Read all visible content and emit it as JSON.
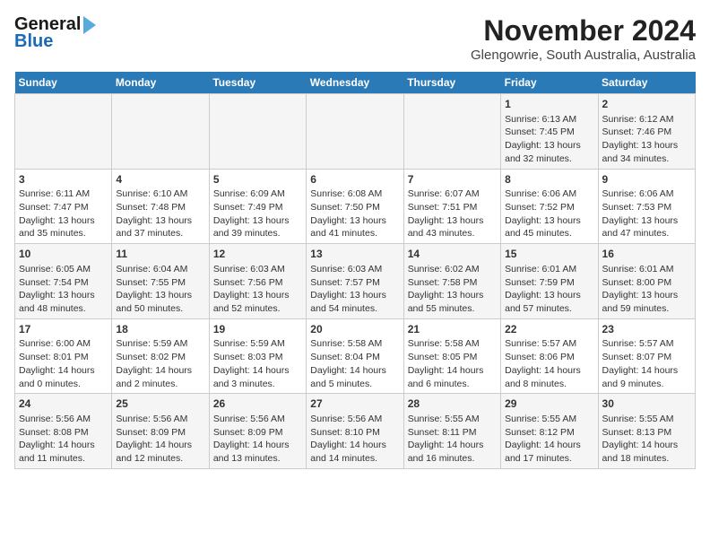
{
  "header": {
    "logo_line1": "General",
    "logo_line2": "Blue",
    "title": "November 2024",
    "subtitle": "Glengowrie, South Australia, Australia"
  },
  "calendar": {
    "days_of_week": [
      "Sunday",
      "Monday",
      "Tuesday",
      "Wednesday",
      "Thursday",
      "Friday",
      "Saturday"
    ],
    "weeks": [
      [
        {
          "day": "",
          "info": ""
        },
        {
          "day": "",
          "info": ""
        },
        {
          "day": "",
          "info": ""
        },
        {
          "day": "",
          "info": ""
        },
        {
          "day": "",
          "info": ""
        },
        {
          "day": "1",
          "info": "Sunrise: 6:13 AM\nSunset: 7:45 PM\nDaylight: 13 hours and 32 minutes."
        },
        {
          "day": "2",
          "info": "Sunrise: 6:12 AM\nSunset: 7:46 PM\nDaylight: 13 hours and 34 minutes."
        }
      ],
      [
        {
          "day": "3",
          "info": "Sunrise: 6:11 AM\nSunset: 7:47 PM\nDaylight: 13 hours and 35 minutes."
        },
        {
          "day": "4",
          "info": "Sunrise: 6:10 AM\nSunset: 7:48 PM\nDaylight: 13 hours and 37 minutes."
        },
        {
          "day": "5",
          "info": "Sunrise: 6:09 AM\nSunset: 7:49 PM\nDaylight: 13 hours and 39 minutes."
        },
        {
          "day": "6",
          "info": "Sunrise: 6:08 AM\nSunset: 7:50 PM\nDaylight: 13 hours and 41 minutes."
        },
        {
          "day": "7",
          "info": "Sunrise: 6:07 AM\nSunset: 7:51 PM\nDaylight: 13 hours and 43 minutes."
        },
        {
          "day": "8",
          "info": "Sunrise: 6:06 AM\nSunset: 7:52 PM\nDaylight: 13 hours and 45 minutes."
        },
        {
          "day": "9",
          "info": "Sunrise: 6:06 AM\nSunset: 7:53 PM\nDaylight: 13 hours and 47 minutes."
        }
      ],
      [
        {
          "day": "10",
          "info": "Sunrise: 6:05 AM\nSunset: 7:54 PM\nDaylight: 13 hours and 48 minutes."
        },
        {
          "day": "11",
          "info": "Sunrise: 6:04 AM\nSunset: 7:55 PM\nDaylight: 13 hours and 50 minutes."
        },
        {
          "day": "12",
          "info": "Sunrise: 6:03 AM\nSunset: 7:56 PM\nDaylight: 13 hours and 52 minutes."
        },
        {
          "day": "13",
          "info": "Sunrise: 6:03 AM\nSunset: 7:57 PM\nDaylight: 13 hours and 54 minutes."
        },
        {
          "day": "14",
          "info": "Sunrise: 6:02 AM\nSunset: 7:58 PM\nDaylight: 13 hours and 55 minutes."
        },
        {
          "day": "15",
          "info": "Sunrise: 6:01 AM\nSunset: 7:59 PM\nDaylight: 13 hours and 57 minutes."
        },
        {
          "day": "16",
          "info": "Sunrise: 6:01 AM\nSunset: 8:00 PM\nDaylight: 13 hours and 59 minutes."
        }
      ],
      [
        {
          "day": "17",
          "info": "Sunrise: 6:00 AM\nSunset: 8:01 PM\nDaylight: 14 hours and 0 minutes."
        },
        {
          "day": "18",
          "info": "Sunrise: 5:59 AM\nSunset: 8:02 PM\nDaylight: 14 hours and 2 minutes."
        },
        {
          "day": "19",
          "info": "Sunrise: 5:59 AM\nSunset: 8:03 PM\nDaylight: 14 hours and 3 minutes."
        },
        {
          "day": "20",
          "info": "Sunrise: 5:58 AM\nSunset: 8:04 PM\nDaylight: 14 hours and 5 minutes."
        },
        {
          "day": "21",
          "info": "Sunrise: 5:58 AM\nSunset: 8:05 PM\nDaylight: 14 hours and 6 minutes."
        },
        {
          "day": "22",
          "info": "Sunrise: 5:57 AM\nSunset: 8:06 PM\nDaylight: 14 hours and 8 minutes."
        },
        {
          "day": "23",
          "info": "Sunrise: 5:57 AM\nSunset: 8:07 PM\nDaylight: 14 hours and 9 minutes."
        }
      ],
      [
        {
          "day": "24",
          "info": "Sunrise: 5:56 AM\nSunset: 8:08 PM\nDaylight: 14 hours and 11 minutes."
        },
        {
          "day": "25",
          "info": "Sunrise: 5:56 AM\nSunset: 8:09 PM\nDaylight: 14 hours and 12 minutes."
        },
        {
          "day": "26",
          "info": "Sunrise: 5:56 AM\nSunset: 8:09 PM\nDaylight: 14 hours and 13 minutes."
        },
        {
          "day": "27",
          "info": "Sunrise: 5:56 AM\nSunset: 8:10 PM\nDaylight: 14 hours and 14 minutes."
        },
        {
          "day": "28",
          "info": "Sunrise: 5:55 AM\nSunset: 8:11 PM\nDaylight: 14 hours and 16 minutes."
        },
        {
          "day": "29",
          "info": "Sunrise: 5:55 AM\nSunset: 8:12 PM\nDaylight: 14 hours and 17 minutes."
        },
        {
          "day": "30",
          "info": "Sunrise: 5:55 AM\nSunset: 8:13 PM\nDaylight: 14 hours and 18 minutes."
        }
      ]
    ]
  }
}
